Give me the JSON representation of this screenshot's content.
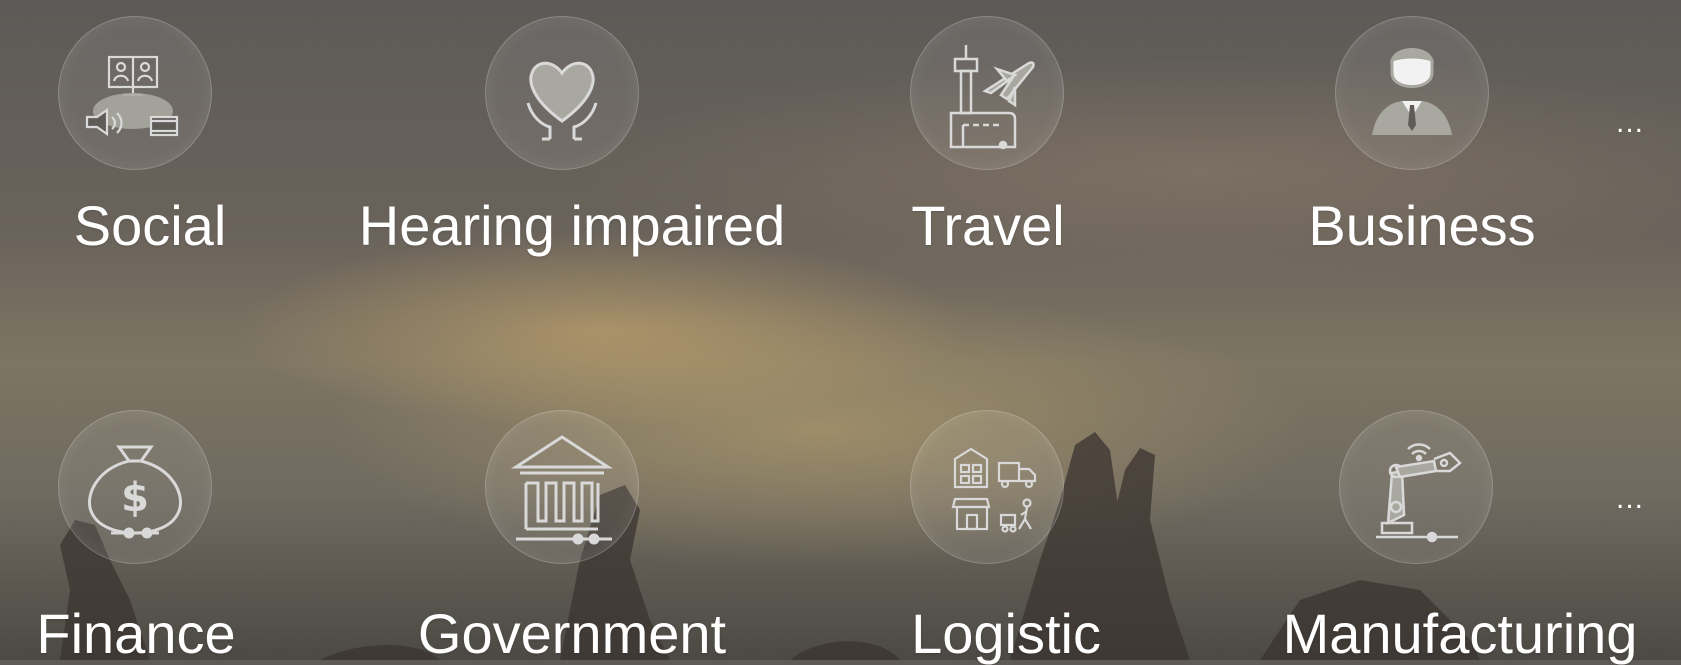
{
  "categories": [
    {
      "label": "Social",
      "icon": "social-media-icon"
    },
    {
      "label": "Hearing impaired",
      "icon": "heart-hands-icon"
    },
    {
      "label": "Travel",
      "icon": "airport-plane-icon"
    },
    {
      "label": "Business",
      "icon": "businessman-icon"
    },
    {
      "label": "Finance",
      "icon": "money-bag-icon"
    },
    {
      "label": "Government",
      "icon": "government-building-icon"
    },
    {
      "label": "Logistic",
      "icon": "logistics-icon"
    },
    {
      "label": "Manufacturing",
      "icon": "robot-arm-icon"
    }
  ],
  "more_label": "...",
  "colors": {
    "text": "#ffffff",
    "icon_stroke": "#d9d9d9",
    "icon_fill": "#a9a8a0"
  }
}
